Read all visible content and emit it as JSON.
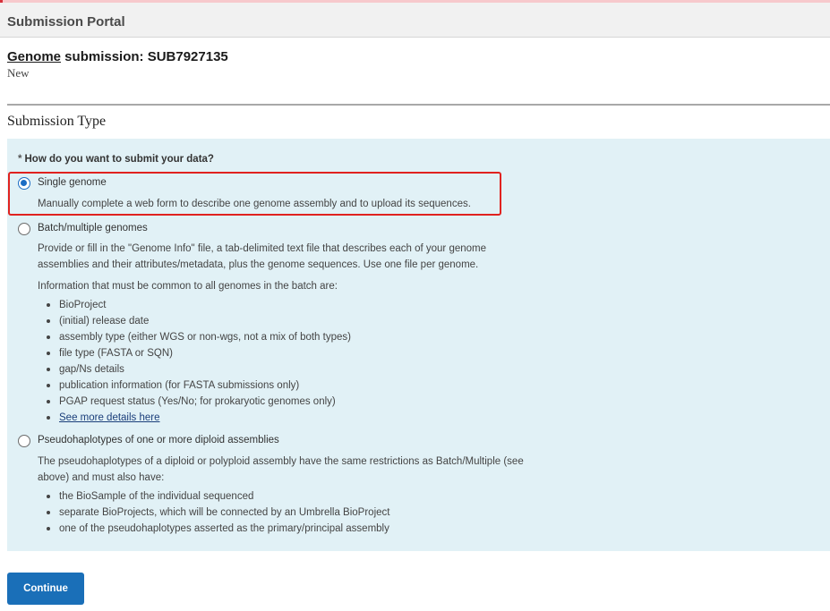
{
  "header": {
    "portal_title": "Submission Portal"
  },
  "submission": {
    "title_prefix": "Genome",
    "title_rest": " submission: SUB7927135",
    "status": "New"
  },
  "section": {
    "heading": "Submission Type"
  },
  "question": {
    "required_mark": "*",
    "text": "How do you want to submit your data?"
  },
  "options": [
    {
      "label": "Single genome",
      "selected": true,
      "desc": [
        "Manually complete a web form to describe one genome assembly and to upload its sequences."
      ]
    },
    {
      "label": "Batch/multiple genomes",
      "selected": false,
      "desc": [
        "Provide or fill in the \"Genome Info\" file, a tab-delimited text file that describes each of your genome",
        "assemblies and their attributes/metadata, plus the genome sequences. Use one file per genome.",
        "Information that must be common to all genomes in the batch are:"
      ],
      "bullets": [
        "BioProject",
        "(initial) release date",
        "assembly type (either WGS or non-wgs, not a mix of both types)",
        "file type (FASTA or SQN)",
        "gap/Ns details",
        "publication information (for FASTA submissions only)",
        "PGAP request status (Yes/No; for prokaryotic genomes only)"
      ],
      "link": "See more details here"
    },
    {
      "label": "Pseudohaplotypes of one or more diploid assemblies",
      "selected": false,
      "desc": [
        "The pseudohaplotypes of a diploid or polyploid assembly have the same restrictions as Batch/Multiple (see",
        "above) and must also have:"
      ],
      "bullets": [
        "the BioSample of the individual sequenced",
        "separate BioProjects, which will be connected by an Umbrella BioProject",
        "one of the pseudohaplotypes asserted as the primary/principal assembly"
      ]
    }
  ],
  "actions": {
    "continue_label": "Continue"
  },
  "colors": {
    "panel_bg": "#e1f1f6",
    "primary_button": "#1a6fb8",
    "highlight_border": "#e0221f",
    "radio_selected": "#1b6cc4"
  }
}
